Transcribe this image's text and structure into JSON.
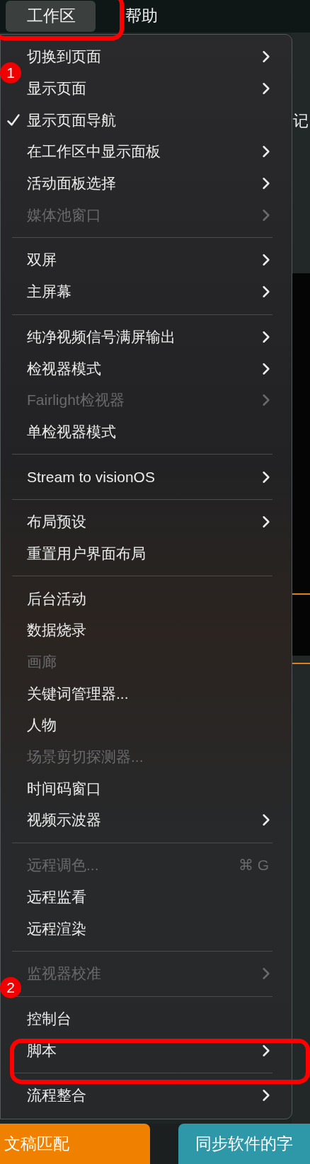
{
  "menu_bar": {
    "items": [
      {
        "label": "工作区",
        "selected": true
      },
      {
        "label": "帮助",
        "selected": false
      }
    ]
  },
  "menu": {
    "sections": [
      {
        "items": [
          {
            "label": "切换到页面",
            "checked": false,
            "disabled": false,
            "submenu": true
          },
          {
            "label": "显示页面",
            "checked": false,
            "disabled": false,
            "submenu": true
          },
          {
            "label": "显示页面导航",
            "checked": true,
            "disabled": false,
            "submenu": false
          },
          {
            "label": "在工作区中显示面板",
            "checked": false,
            "disabled": false,
            "submenu": true
          },
          {
            "label": "活动面板选择",
            "checked": false,
            "disabled": false,
            "submenu": true
          },
          {
            "label": "媒体池窗口",
            "checked": false,
            "disabled": true,
            "submenu": true
          }
        ]
      },
      {
        "items": [
          {
            "label": "双屏",
            "checked": false,
            "disabled": false,
            "submenu": true
          },
          {
            "label": "主屏幕",
            "checked": false,
            "disabled": false,
            "submenu": true
          }
        ]
      },
      {
        "items": [
          {
            "label": "纯净视频信号满屏输出",
            "checked": false,
            "disabled": false,
            "submenu": true
          },
          {
            "label": "检视器模式",
            "checked": false,
            "disabled": false,
            "submenu": true
          },
          {
            "label": "Fairlight检视器",
            "checked": false,
            "disabled": true,
            "submenu": true
          },
          {
            "label": "单检视器模式",
            "checked": false,
            "disabled": false,
            "submenu": false
          }
        ]
      },
      {
        "items": [
          {
            "label": "Stream to visionOS",
            "checked": false,
            "disabled": false,
            "submenu": true
          }
        ]
      },
      {
        "items": [
          {
            "label": "布局预设",
            "checked": false,
            "disabled": false,
            "submenu": true
          },
          {
            "label": "重置用户界面布局",
            "checked": false,
            "disabled": false,
            "submenu": false
          }
        ]
      },
      {
        "items": [
          {
            "label": "后台活动",
            "checked": false,
            "disabled": false,
            "submenu": false
          },
          {
            "label": "数据烧录",
            "checked": false,
            "disabled": false,
            "submenu": false
          },
          {
            "label": "画廊",
            "checked": false,
            "disabled": true,
            "submenu": false
          },
          {
            "label": "关键词管理器...",
            "checked": false,
            "disabled": false,
            "submenu": false
          },
          {
            "label": "人物",
            "checked": false,
            "disabled": false,
            "submenu": false
          },
          {
            "label": "场景剪切探测器...",
            "checked": false,
            "disabled": true,
            "submenu": false
          },
          {
            "label": "时间码窗口",
            "checked": false,
            "disabled": false,
            "submenu": false
          },
          {
            "label": "视频示波器",
            "checked": false,
            "disabled": false,
            "submenu": true
          }
        ]
      },
      {
        "items": [
          {
            "label": "远程调色...",
            "checked": false,
            "disabled": true,
            "submenu": false,
            "shortcut": "⌘ G"
          },
          {
            "label": "远程监看",
            "checked": false,
            "disabled": false,
            "submenu": false
          },
          {
            "label": "远程渲染",
            "checked": false,
            "disabled": false,
            "submenu": false
          }
        ]
      },
      {
        "items": [
          {
            "label": "监视器校准",
            "checked": false,
            "disabled": true,
            "submenu": true
          }
        ]
      },
      {
        "items": [
          {
            "label": "控制台",
            "checked": false,
            "disabled": false,
            "submenu": false
          },
          {
            "label": "脚本",
            "checked": false,
            "disabled": false,
            "submenu": true
          }
        ]
      },
      {
        "items": [
          {
            "label": "流程整合",
            "checked": false,
            "disabled": false,
            "submenu": true
          }
        ]
      }
    ]
  },
  "callouts": [
    {
      "number": "1"
    },
    {
      "number": "2"
    }
  ],
  "background": {
    "side_label": "记",
    "buttons": [
      {
        "label": "文稿匹配",
        "color": "#f08000"
      },
      {
        "label": "同步软件的字",
        "color": "#2f98a8"
      }
    ]
  }
}
